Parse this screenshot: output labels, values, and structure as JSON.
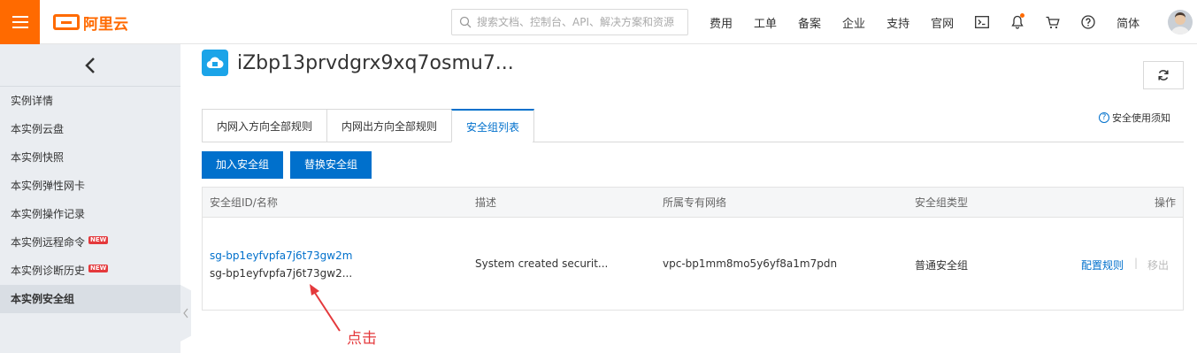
{
  "header": {
    "logo_text": "阿里云",
    "search_placeholder": "搜索文档、控制台、API、解决方案和资源",
    "nav": [
      "费用",
      "工单",
      "备案",
      "企业",
      "支持",
      "官网"
    ],
    "lang": "简体"
  },
  "sidebar": {
    "items": [
      {
        "label": "实例详情"
      },
      {
        "label": "本实例云盘"
      },
      {
        "label": "本实例快照"
      },
      {
        "label": "本实例弹性网卡"
      },
      {
        "label": "本实例操作记录"
      },
      {
        "label": "本实例远程命令",
        "badge": "NEW"
      },
      {
        "label": "本实例诊断历史",
        "badge": "NEW"
      },
      {
        "label": "本实例安全组"
      }
    ]
  },
  "main": {
    "instance_title": "iZbp13prvdgrx9xq7osmu7...",
    "tabs": [
      "内网入方向全部规则",
      "内网出方向全部规则",
      "安全组列表"
    ],
    "notice": "安全使用须知",
    "buttons": {
      "join": "加入安全组",
      "replace": "替换安全组"
    },
    "table": {
      "headers": [
        "安全组ID/名称",
        "描述",
        "所属专有网络",
        "安全组类型",
        "操作"
      ],
      "rows": [
        {
          "id": "sg-bp1eyfvpfa7j6t73gw2m",
          "name": "sg-bp1eyfvpfa7j6t73gw2...",
          "desc": "System created securit...",
          "vpc": "vpc-bp1mm8mo5y6yf8a1m7pdn",
          "type": "普通安全组",
          "action_config": "配置规则",
          "action_sep": "|",
          "action_remove": "移出"
        }
      ]
    }
  },
  "annotation": {
    "text": "点击",
    "color": "#e4393c"
  },
  "colors": {
    "brand": "#ff6a00",
    "primary": "#0070cc"
  }
}
